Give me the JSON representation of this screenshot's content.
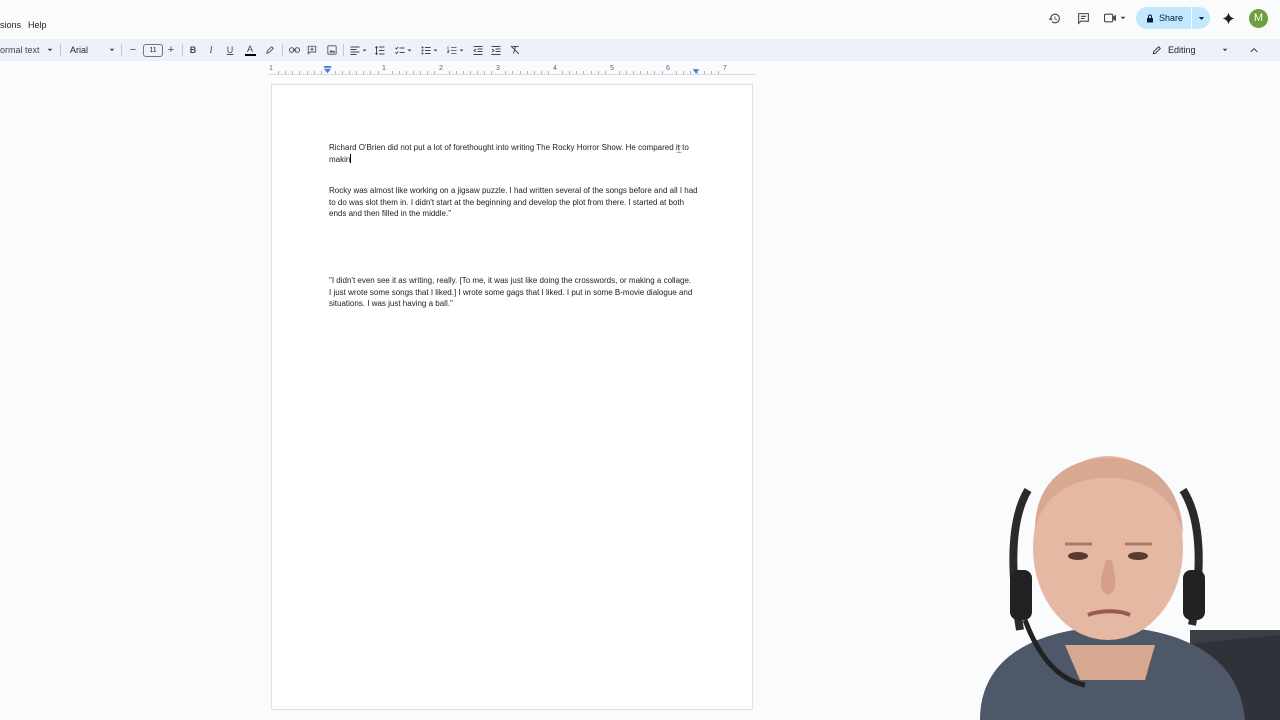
{
  "menu": {
    "extensions_partial": "sions",
    "help": "Help"
  },
  "top_actions": {
    "share_label": "Share",
    "avatar_initial": "M"
  },
  "toolbar": {
    "style_partial": "ormal text",
    "font": "Arial",
    "font_size": "11",
    "minus": "−",
    "plus": "+",
    "bold": "B",
    "italic": "I",
    "underline": "U",
    "text_color": "A",
    "editing_mode": "Editing"
  },
  "ruler": {
    "numbers": [
      "1",
      "1",
      "2",
      "3",
      "4",
      "5",
      "6",
      "7"
    ]
  },
  "document": {
    "para1_text": "Richard O'Brien did not put a lot of forethought into writing The Rocky Horror Show. He compared it to makin",
    "para2_text": "Rocky was almost like working on a jigsaw puzzle. I had written several of the songs before and all I had to do was slot them in. I didn't start at the beginning and develop the plot from there. I started at both ends and then filled in the middle.\"",
    "para3_text": "\"I didn't even see it as writing, really. [To me, it was just like doing the crosswords, or making a collage. I just wrote some songs that I liked.] I wrote some gags that I liked. I put in some B-movie dialogue and situations. I was just having a ball.\""
  },
  "colors": {
    "background": "#f9fbfd",
    "toolbar": "#edf2fa",
    "share": "#c2e7ff",
    "avatar": "#6f9e3e"
  }
}
